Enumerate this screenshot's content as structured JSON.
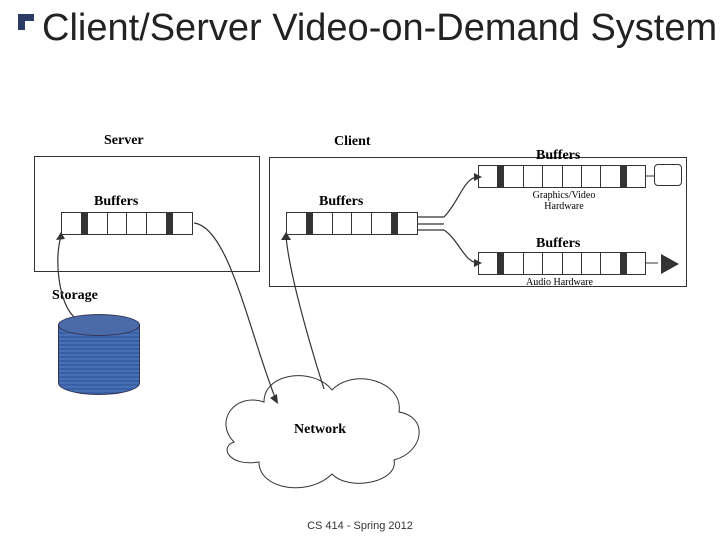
{
  "title": "Client/Server Video-on-Demand System",
  "footer": "CS 414 - Spring 2012",
  "labels": {
    "server": "Server",
    "client": "Client",
    "storage": "Storage",
    "network": "Network",
    "buffers": "Buffers",
    "gvhw": "Graphics/Video\nHardware",
    "audhw": "Audio Hardware"
  }
}
